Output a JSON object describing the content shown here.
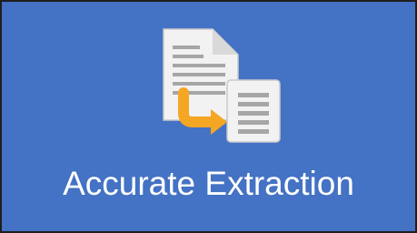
{
  "tile": {
    "title": "Accurate Extraction",
    "icon": "document-extraction-icon",
    "background_color": "#4472c4",
    "accent_color": "#f5a623"
  }
}
